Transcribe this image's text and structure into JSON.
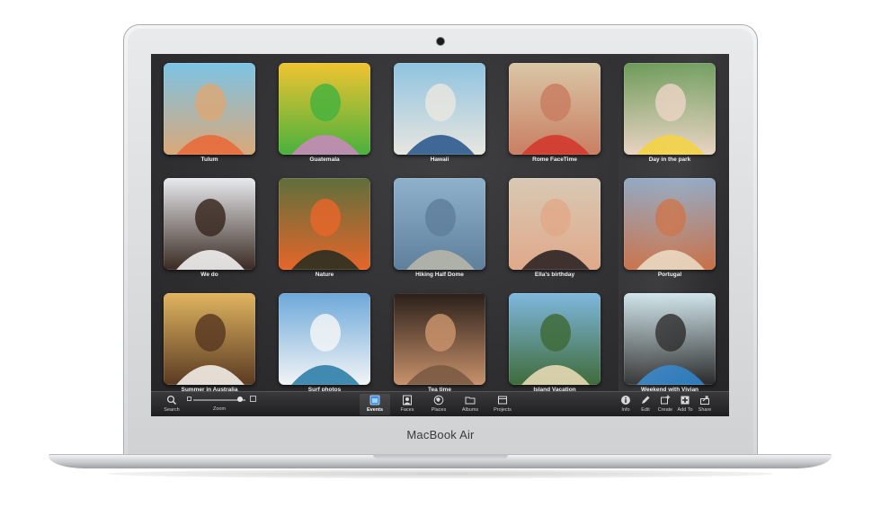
{
  "device": {
    "brand": "MacBook Air"
  },
  "events": [
    {
      "title": "Tulum",
      "palette": [
        "#7dc4e6",
        "#d9a878",
        "#e86a3c"
      ]
    },
    {
      "title": "Guatemala",
      "palette": [
        "#f0c431",
        "#49b13d",
        "#c48ab8"
      ]
    },
    {
      "title": "Hawaii",
      "palette": [
        "#8fc3e0",
        "#e8e6df",
        "#2e5a8f"
      ]
    },
    {
      "title": "Rome FaceTime",
      "palette": [
        "#d9c7a6",
        "#c97e62",
        "#d2382e"
      ]
    },
    {
      "title": "Day in the park",
      "palette": [
        "#6c9a58",
        "#e8d1c0",
        "#f2d03a"
      ]
    },
    {
      "title": "We do",
      "palette": [
        "#e8eaee",
        "#3a2a22",
        "#f1f1f1"
      ]
    },
    {
      "title": "Nature",
      "palette": [
        "#5f6f3c",
        "#e5662a",
        "#2b2d20"
      ]
    },
    {
      "title": "Hiking Half Dome",
      "palette": [
        "#8fb2cc",
        "#5f7f9b",
        "#b7b6aa"
      ]
    },
    {
      "title": "Ella's birthday",
      "palette": [
        "#d8c9b4",
        "#e0a98a",
        "#2d2524"
      ]
    },
    {
      "title": "Portugal",
      "palette": [
        "#8fa7c2",
        "#c86e44",
        "#e8d7bf"
      ]
    },
    {
      "title": "Summer in Australia",
      "palette": [
        "#e0b560",
        "#5a3a22",
        "#f2ede6"
      ]
    },
    {
      "title": "Surf photos",
      "palette": [
        "#6da8d9",
        "#f2f4f6",
        "#2f7ea8"
      ]
    },
    {
      "title": "Tea time",
      "palette": [
        "#2a1f1a",
        "#c8926b",
        "#7a5b44"
      ]
    },
    {
      "title": "Island Vacation",
      "palette": [
        "#7fb8de",
        "#3f6b3a",
        "#e6d9b4"
      ]
    },
    {
      "title": "Weekend with Vivian",
      "palette": [
        "#cfe4ea",
        "#2a2a2a",
        "#2f82c8"
      ]
    }
  ],
  "toolbar": {
    "search": "Search",
    "zoom": "Zoom",
    "views": [
      {
        "label": "Events",
        "icon": "events-icon",
        "active": true
      },
      {
        "label": "Faces",
        "icon": "faces-icon",
        "active": false
      },
      {
        "label": "Places",
        "icon": "places-icon",
        "active": false
      },
      {
        "label": "Albums",
        "icon": "albums-icon",
        "active": false
      },
      {
        "label": "Projects",
        "icon": "projects-icon",
        "active": false
      }
    ],
    "actions": [
      {
        "label": "Info",
        "icon": "info-icon"
      },
      {
        "label": "Edit",
        "icon": "edit-icon"
      },
      {
        "label": "Create",
        "icon": "create-icon"
      },
      {
        "label": "Add To",
        "icon": "add-to-icon"
      },
      {
        "label": "Share",
        "icon": "share-icon"
      }
    ]
  }
}
